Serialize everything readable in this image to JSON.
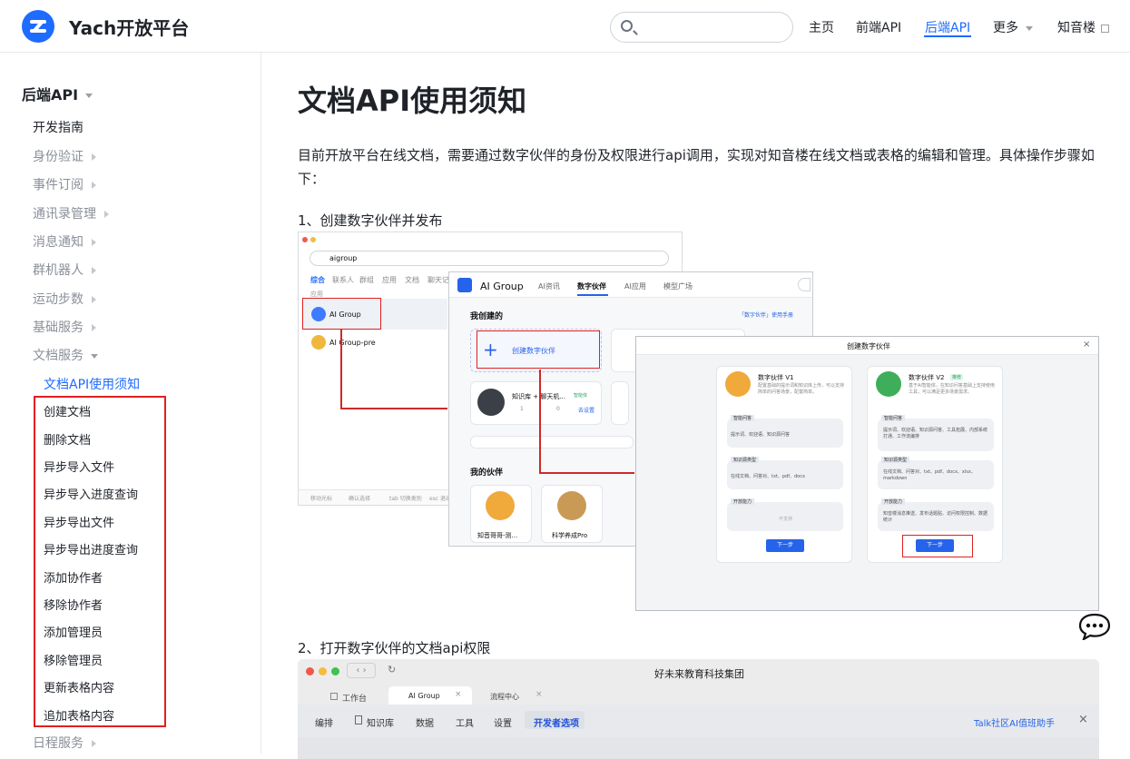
{
  "header": {
    "brand": "Yach开放平台",
    "search_placeholder": "",
    "nav": [
      "主页",
      "前端API",
      "后端API",
      "更多",
      "知音楼"
    ]
  },
  "sidebar": {
    "section": "后端API",
    "items": [
      "开发指南",
      "身份验证",
      "事件订阅",
      "通讯录管理",
      "消息通知",
      "群机器人",
      "运动步数",
      "基础服务",
      "文档服务"
    ],
    "active": "文档API使用须知",
    "sub_items": [
      "创建文档",
      "删除文档",
      "异步导入文件",
      "异步导入进度查询",
      "异步导出文件",
      "异步导出进度查询",
      "添加协作者",
      "移除协作者",
      "添加管理员",
      "移除管理员",
      "更新表格内容",
      "追加表格内容"
    ],
    "last": "日程服务"
  },
  "content": {
    "title": "文档API使用须知",
    "intro": "目前开放平台在线文档，需要通过数字伙伴的身份及权限进行api调用，实现对知音楼在线文档或表格的编辑和管理。具体操作步骤如下：",
    "step1": "1、创建数字伙伴并发布",
    "step2": "2、打开数字伙伴的文档api权限"
  },
  "shotA": {
    "query": "aigroup",
    "tabs": [
      "综合",
      "联系人",
      "群组",
      "应用",
      "文档",
      "聊天记录"
    ],
    "section": "应用",
    "apps": [
      "AI Group",
      "AI Group-pre"
    ],
    "footer": [
      "移动光标",
      "确认选择",
      "tab 切换类别",
      "esc 退出"
    ]
  },
  "shotB": {
    "app": "AI Group",
    "tabs": [
      "AI资讯",
      "数字伙伴",
      "AI应用",
      "模型广场"
    ],
    "search": "搜索",
    "mine": "我创建的",
    "manual": "「数字伙伴」使用手册",
    "create": "创建数字伙伴",
    "card_title": "知识库 + 聊天机...",
    "card_badge": "智能体",
    "card_stats": [
      "1",
      "0"
    ],
    "card_link": "去设置",
    "partners": "我的伙伴",
    "partner_names": [
      "知音哥哥-测...",
      "科学养成Pro"
    ]
  },
  "shotC": {
    "title": "创建数字伙伴",
    "close": "×",
    "v1": {
      "name": "数字伙伴 V1",
      "desc": "配置基础的提示词和知识库上传，可以支持简单的问答场景，配置简单。",
      "s1": "智能问答",
      "s1v": "提示词、欢迎语、知识源问答",
      "s2": "知识源类型",
      "s2v": "在线文档、问答对、txt、pdf、docx",
      "s3": "开放能力",
      "s3v": "不支持",
      "btn": "下一步"
    },
    "v2": {
      "name": "数字伙伴 V2",
      "badge": "推荐",
      "desc": "基于AI智能体，在知识问答基础上支持使用工具，可以满足更多场景需求。",
      "s1": "智能问答",
      "s1v": "提示词、欢迎语、知识源问答、工具拓展、内部系统打通、工作流编排",
      "s2": "知识源类型",
      "s2v": "在线文档、问答对、txt、pdf、docx、xlsx、markdown",
      "s3": "开放能力",
      "s3v": "知音楼消息推送、发布话题贴、访问权限控制、数据统计",
      "btn": "下一步"
    }
  },
  "shotD": {
    "window_title": "好未来教育科技集团",
    "tabs": [
      "工作台",
      "AI Group",
      "流程中心"
    ],
    "menu": [
      "编排",
      "知识库",
      "数据",
      "工具",
      "设置",
      "开发者选项"
    ],
    "right": "Talk社区AI值班助手"
  }
}
